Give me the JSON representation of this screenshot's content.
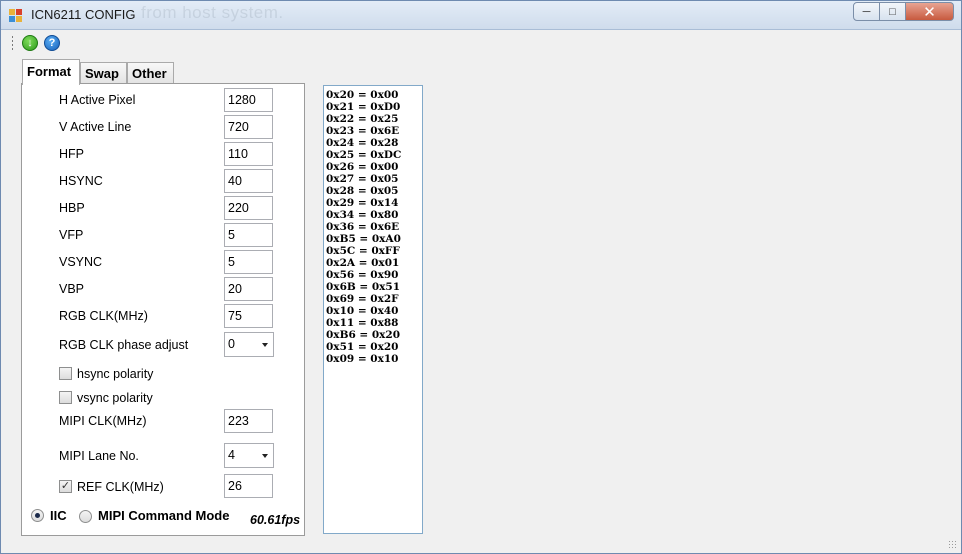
{
  "window": {
    "title": "ICN6211 CONFIG",
    "ghost_text": "from host system."
  },
  "toolbar": {
    "green_icon": "go-green-icon",
    "help_icon": "help-blue-icon",
    "help_glyph": "?"
  },
  "tabs": [
    "Format",
    "Swap",
    "Other"
  ],
  "format": {
    "h_active_pixel": {
      "label": "H Active Pixel",
      "value": "1280"
    },
    "v_active_line": {
      "label": "V Active Line",
      "value": "720"
    },
    "hfp": {
      "label": "HFP",
      "value": "110"
    },
    "hsync": {
      "label": "HSYNC",
      "value": "40"
    },
    "hbp": {
      "label": "HBP",
      "value": "220"
    },
    "vfp": {
      "label": "VFP",
      "value": "5"
    },
    "vsync": {
      "label": "VSYNC",
      "value": "5"
    },
    "vbp": {
      "label": "VBP",
      "value": "20"
    },
    "rgb_clk": {
      "label": "RGB CLK(MHz)",
      "value": "75"
    },
    "rgb_clk_phase": {
      "label": "RGB CLK phase adjust",
      "value": "0"
    },
    "hsync_polarity": {
      "label": "hsync polarity",
      "checked": false
    },
    "vsync_polarity": {
      "label": "vsync polarity",
      "checked": false
    },
    "mipi_clk": {
      "label": "MIPI CLK(MHz)",
      "value": "223"
    },
    "mipi_lane": {
      "label": "MIPI Lane No.",
      "value": "4"
    },
    "ref_clk": {
      "label": "REF CLK(MHz)",
      "value": "26",
      "checked": true
    },
    "check_mark": "✓",
    "mode_iic": {
      "label": "IIC",
      "selected": true
    },
    "mode_mipi_cmd": {
      "label": "MIPI Command Mode",
      "selected": false
    },
    "fps": "60.61fps"
  },
  "registers": [
    "0x20 = 0x00",
    "0x21 = 0xD0",
    "0x22 = 0x25",
    "0x23 = 0x6E",
    "0x24 = 0x28",
    "0x25 = 0xDC",
    "0x26 = 0x00",
    "0x27 = 0x05",
    "0x28 = 0x05",
    "0x29 = 0x14",
    "0x34 = 0x80",
    "0x36 = 0x6E",
    "0xB5 = 0xA0",
    "0x5C = 0xFF",
    "0x2A = 0x01",
    "0x56 = 0x90",
    "0x6B = 0x51",
    "0x69 = 0x2F",
    "0x10 = 0x40",
    "0x11 = 0x88",
    "0xB6 = 0x20",
    "0x51 = 0x20",
    "0x09 = 0x10"
  ]
}
